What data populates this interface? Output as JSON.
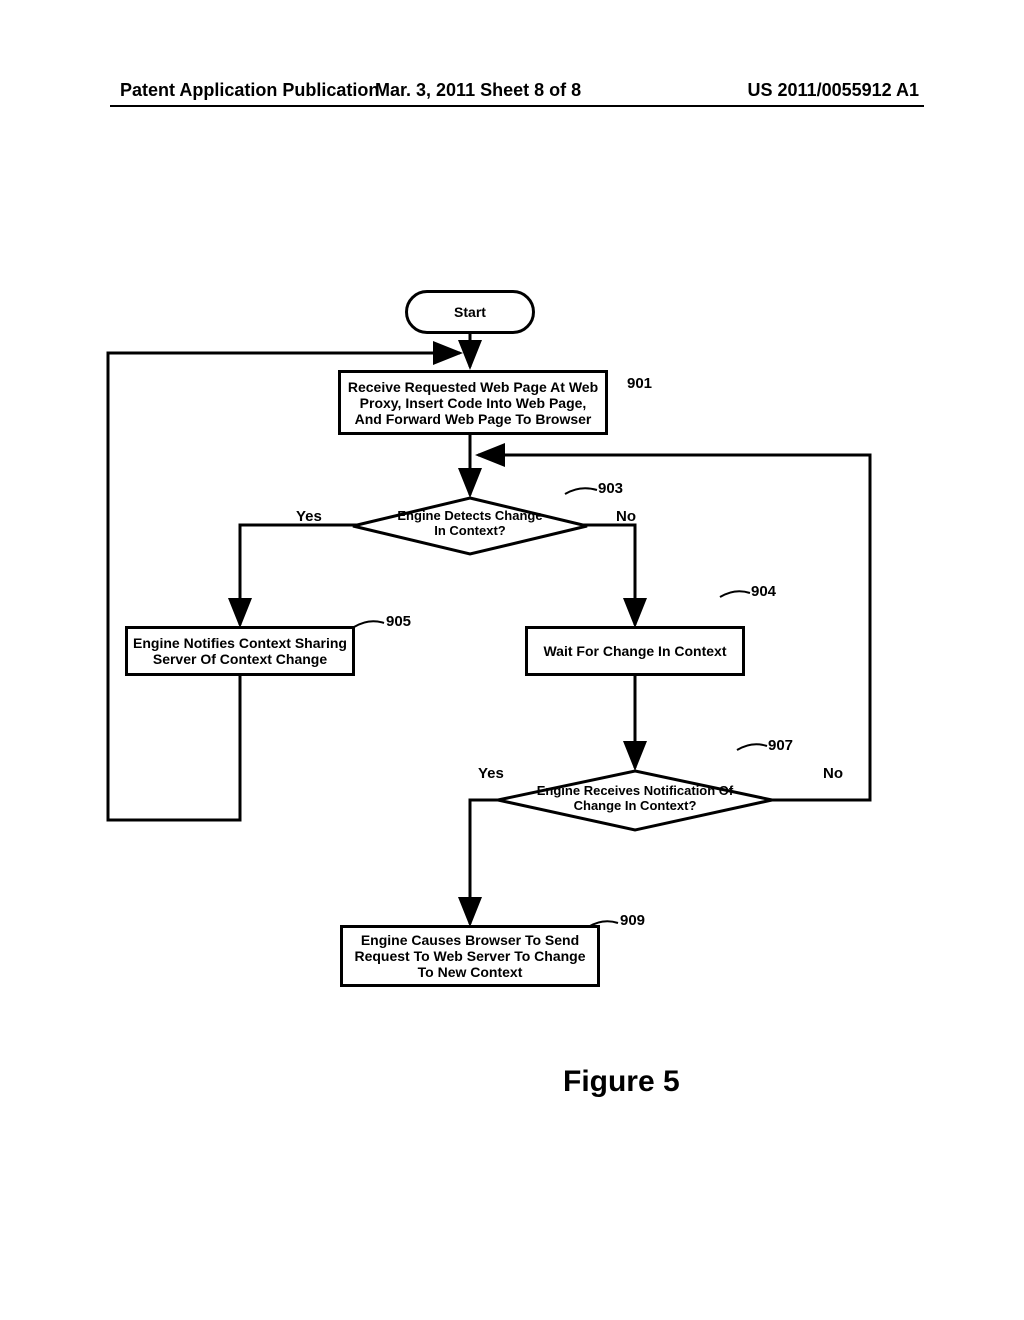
{
  "header": {
    "left": "Patent Application Publication",
    "center": "Mar. 3, 2011  Sheet 8 of 8",
    "right": "US 2011/0055912 A1"
  },
  "flowchart": {
    "start": "Start",
    "step_901": "Receive Requested Web Page At Web Proxy, Insert Code Into Web Page, And Forward Web Page To Browser",
    "decision_903": "Engine Detects Change In Context?",
    "step_904": "Wait For Change In Context",
    "step_905": "Engine Notifies Context Sharing Server Of Context Change",
    "decision_907": "Engine Receives Notification Of Change In Context?",
    "step_909": "Engine Causes Browser To Send Request To Web Server To Change To New Context",
    "yes": "Yes",
    "no": "No"
  },
  "refs": {
    "r901": "901",
    "r903": "903",
    "r904": "904",
    "r905": "905",
    "r907": "907",
    "r909": "909"
  },
  "figure_label": "Figure 5"
}
